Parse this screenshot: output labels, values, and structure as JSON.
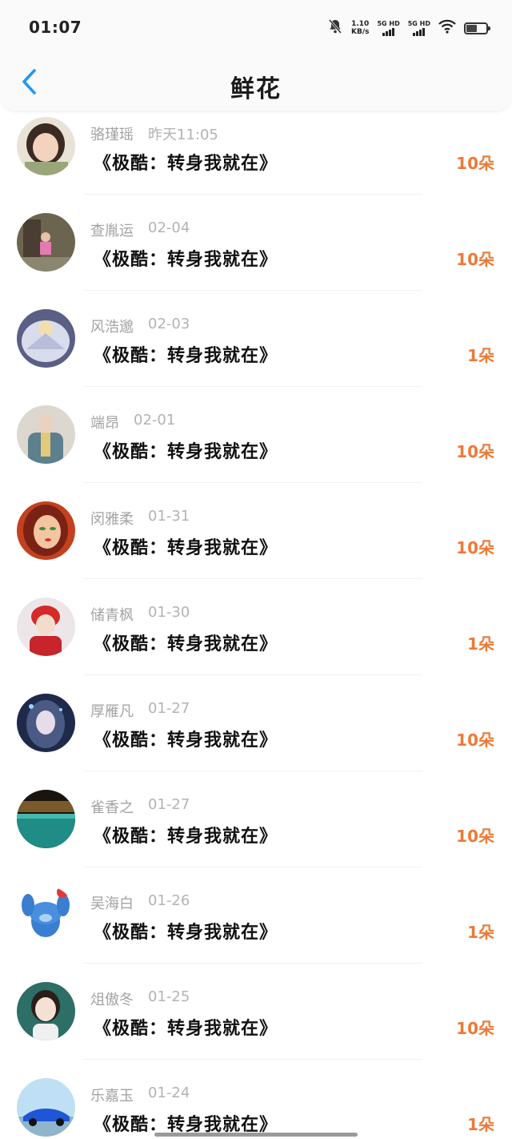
{
  "status_bar": {
    "time": "01:07",
    "net_speed_value": "1.10",
    "net_speed_unit": "KB/s",
    "sim1_label": "5G HD",
    "sim2_label": "5G HD"
  },
  "header": {
    "title": "鲜花",
    "back_icon": "chevron-left-icon"
  },
  "colors": {
    "accent": "#2196f3",
    "flower_count": "#ec7a36",
    "meta": "#a3a3a3"
  },
  "items": [
    {
      "name": "骆瑾瑶",
      "date": "昨天11:05",
      "title": "《极酷：转身我就在》",
      "flowers": "10朵"
    },
    {
      "name": "查胤运",
      "date": "02-04",
      "title": "《极酷：转身我就在》",
      "flowers": "10朵"
    },
    {
      "name": "风浩邈",
      "date": "02-03",
      "title": "《极酷：转身我就在》",
      "flowers": "1朵"
    },
    {
      "name": "端昂",
      "date": "02-01",
      "title": "《极酷：转身我就在》",
      "flowers": "10朵"
    },
    {
      "name": "闵雅柔",
      "date": "01-31",
      "title": "《极酷：转身我就在》",
      "flowers": "10朵"
    },
    {
      "name": "储青枫",
      "date": "01-30",
      "title": "《极酷：转身我就在》",
      "flowers": "1朵"
    },
    {
      "name": "厚雁凡",
      "date": "01-27",
      "title": "《极酷：转身我就在》",
      "flowers": "10朵"
    },
    {
      "name": "雀香之",
      "date": "01-27",
      "title": "《极酷：转身我就在》",
      "flowers": "10朵"
    },
    {
      "name": "吴海白",
      "date": "01-26",
      "title": "《极酷：转身我就在》",
      "flowers": "1朵"
    },
    {
      "name": "俎傲冬",
      "date": "01-25",
      "title": "《极酷：转身我就在》",
      "flowers": "10朵"
    },
    {
      "name": "乐嘉玉",
      "date": "01-24",
      "title": "《极酷：转身我就在》",
      "flowers": "1朵"
    }
  ]
}
